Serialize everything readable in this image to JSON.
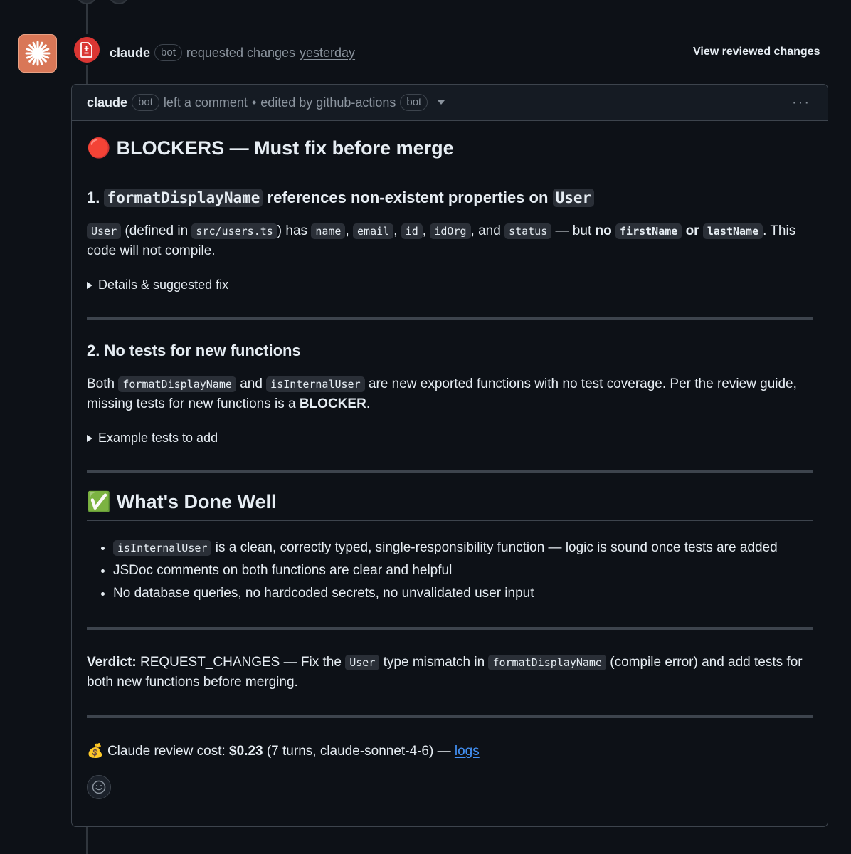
{
  "review": {
    "author": "claude",
    "bot_label": "bot",
    "action": "requested changes",
    "when": "yesterday",
    "view_changes": "View reviewed changes"
  },
  "comment_header": {
    "author": "claude",
    "bot_label": "bot",
    "action": "left a comment",
    "separator": "•",
    "edited_by": "edited by github-actions",
    "editor_bot_label": "bot",
    "menu": "···"
  },
  "blockers": {
    "emoji": "🔴",
    "title": "BLOCKERS — Must fix before merge",
    "item1": {
      "num": "1.",
      "code": "formatDisplayName",
      "text_a": "references non-existent properties on",
      "code_user": "User",
      "p_user": "User",
      "p_t1": "(defined in",
      "p_file": "src/users.ts",
      "p_t2": ") has",
      "p_c_name": "name",
      "p_c_email": "email",
      "p_c_id": "id",
      "p_c_idorg": "idOrg",
      "p_t3": ", and",
      "p_c_status": "status",
      "p_t4": "— but",
      "p_no": "no",
      "p_c_first": "firstName",
      "p_or": "or",
      "p_c_last": "lastName",
      "p_t5": ". This code will not compile.",
      "details": "Details & suggested fix"
    },
    "item2": {
      "title": "2. No tests for new functions",
      "t1": "Both",
      "c1": "formatDisplayName",
      "t2": "and",
      "c2": "isInternalUser",
      "t3": "are new exported functions with no test coverage. Per the review guide, missing tests for new functions is a",
      "strong": "BLOCKER",
      "t4": ".",
      "details": "Example tests to add"
    }
  },
  "done_well": {
    "emoji": "✅",
    "title": "What's Done Well",
    "item1_code": "isInternalUser",
    "item1_text": "is a clean, correctly typed, single-responsibility function — logic is sound once tests are added",
    "item2": "JSDoc comments on both functions are clear and helpful",
    "item3": "No database queries, no hardcoded secrets, no unvalidated user input"
  },
  "verdict": {
    "label": "Verdict:",
    "t1": "REQUEST_CHANGES — Fix the",
    "c1": "User",
    "t2": "type mismatch in",
    "c2": "formatDisplayName",
    "t3": "(compile error) and add tests for both new functions before merging."
  },
  "cost": {
    "emoji": "💰",
    "t1": "Claude review cost:",
    "amount": "$0.23",
    "t2": "(7 turns, claude-sonnet-4-6) —",
    "link": "logs"
  },
  "colors": {
    "background": "#0d1117",
    "border": "#3d444d",
    "danger": "#da3633",
    "avatar": "#d97757",
    "link": "#4493f8"
  }
}
